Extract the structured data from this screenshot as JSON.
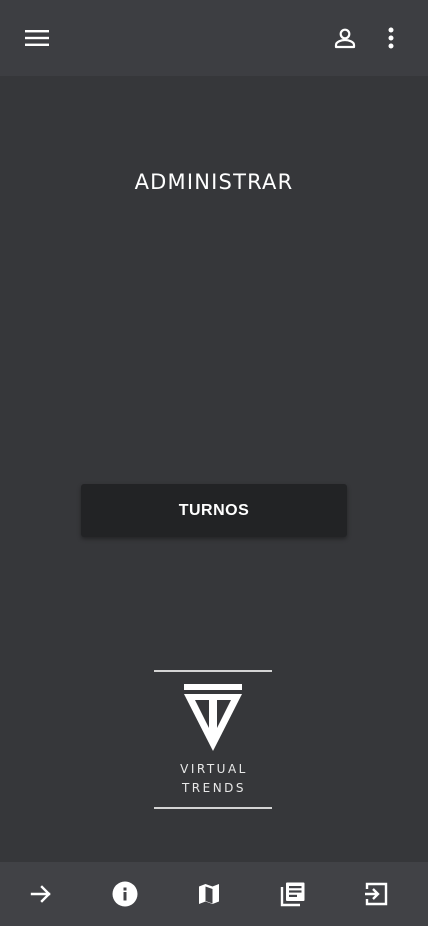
{
  "header": {
    "menu_icon": "menu-icon",
    "account_icon": "account-icon",
    "more_icon": "more-vert-icon"
  },
  "main": {
    "title": "ADMINISTRAR",
    "turnos_button_label": "TURNOS"
  },
  "brand": {
    "line1": "VIRTUAL",
    "line2": "TRENDS"
  },
  "bottom_nav": {
    "items": [
      {
        "icon": "arrow-forward-icon"
      },
      {
        "icon": "info-icon"
      },
      {
        "icon": "map-icon"
      },
      {
        "icon": "news-icon"
      },
      {
        "icon": "exit-icon"
      }
    ]
  },
  "colors": {
    "background": "#36373a",
    "top_bar": "#3d3e42",
    "bottom_bar": "#414246",
    "button": "#222325",
    "text": "#ffffff"
  }
}
